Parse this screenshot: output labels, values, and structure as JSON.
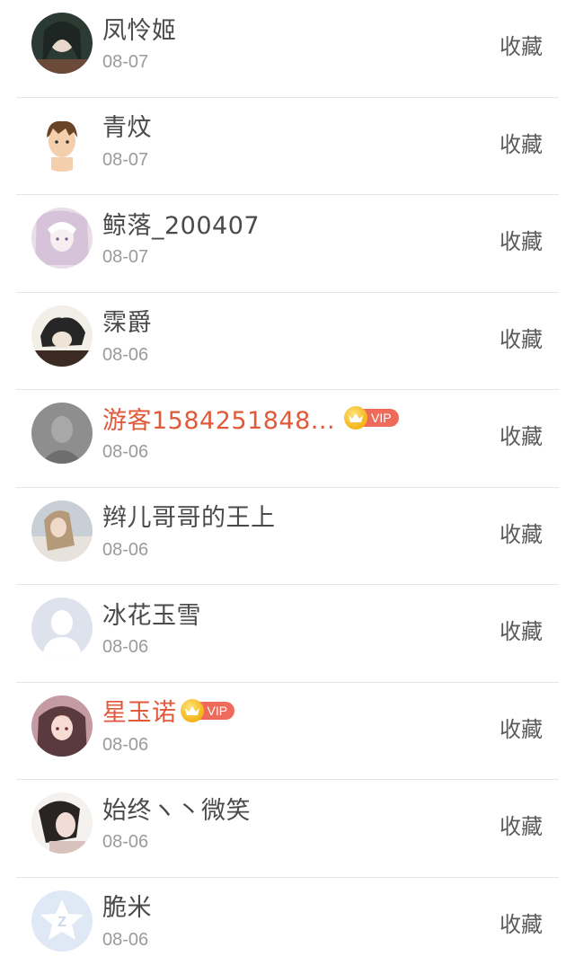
{
  "items": [
    {
      "name": "凤怜姬",
      "date": "08-07",
      "action": "收藏",
      "vip": false,
      "vip_label": "",
      "avatar": "anime-girl-dark"
    },
    {
      "name": "青炆",
      "date": "08-07",
      "action": "收藏",
      "vip": false,
      "vip_label": "",
      "avatar": "cartoon-boy"
    },
    {
      "name": "鲸落_200407",
      "date": "08-07",
      "action": "收藏",
      "vip": false,
      "vip_label": "",
      "avatar": "anime-girl-pale"
    },
    {
      "name": "霂爵",
      "date": "08-06",
      "action": "收藏",
      "vip": false,
      "vip_label": "",
      "avatar": "ink-figure"
    },
    {
      "name": "游客1584251848...",
      "date": "08-06",
      "action": "收藏",
      "vip": true,
      "vip_label": "VIP",
      "avatar": "gray-photo"
    },
    {
      "name": "辫儿哥哥的王上",
      "date": "08-06",
      "action": "收藏",
      "vip": false,
      "vip_label": "",
      "avatar": "girl-photo"
    },
    {
      "name": "冰花玉雪",
      "date": "08-06",
      "action": "收藏",
      "vip": false,
      "vip_label": "",
      "avatar": "default-person"
    },
    {
      "name": "星玉诺",
      "date": "08-06",
      "action": "收藏",
      "vip": true,
      "vip_label": "VIP",
      "avatar": "anime-girl-pink"
    },
    {
      "name": "始终ヽ丶微笑",
      "date": "08-06",
      "action": "收藏",
      "vip": false,
      "vip_label": "",
      "avatar": "woman-photo"
    },
    {
      "name": "脆米",
      "date": "08-06",
      "action": "收藏",
      "vip": false,
      "vip_label": "",
      "avatar": "qq-logo"
    }
  ],
  "colors": {
    "name_default": "#4a4a4a",
    "name_vip": "#e05a3a",
    "date": "#9b9b9b",
    "action": "#5a5a5a",
    "vip_tag": "#ee6b5b",
    "crown": "#f3b416",
    "divider": "#e5e5e5"
  }
}
